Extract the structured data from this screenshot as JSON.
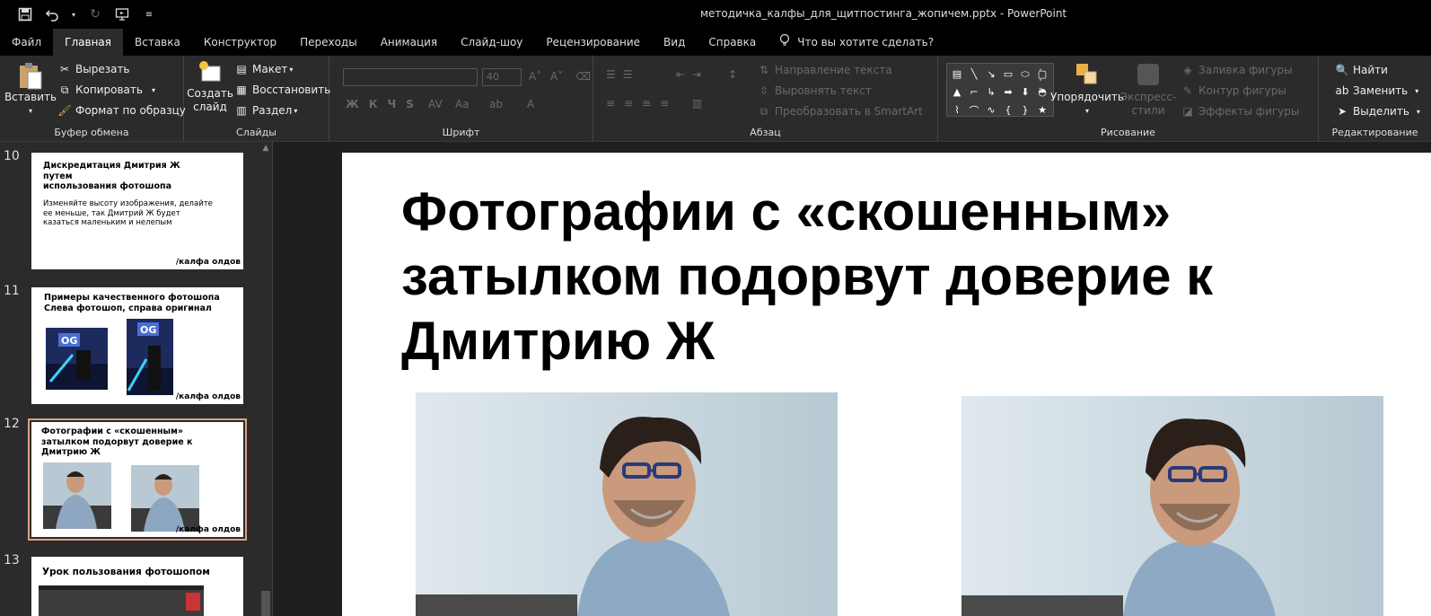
{
  "titlebar": {
    "title": "методичка_калфы_для_щитпостинга_жопичем.pptx  -  PowerPoint",
    "icons": [
      "save-icon",
      "undo-icon",
      "redo-icon",
      "present-icon",
      "customize-icon"
    ]
  },
  "tabs": [
    "Файл",
    "Главная",
    "Вставка",
    "Конструктор",
    "Переходы",
    "Анимация",
    "Слайд-шоу",
    "Рецензирование",
    "Вид",
    "Справка"
  ],
  "tell_me": "Что вы хотите сделать?",
  "ribbon": {
    "clipboard": {
      "paste": "Вставить",
      "cut": "Вырезать",
      "copy": "Копировать",
      "format_painter": "Формат по образцу",
      "label": "Буфер обмена"
    },
    "slides": {
      "new_slide_1": "Создать",
      "new_slide_2": "слайд",
      "layout": "Макет",
      "reset": "Восстановить",
      "section": "Раздел",
      "label": "Слайды"
    },
    "font": {
      "label": "Шрифт",
      "size": "40"
    },
    "paragraph": {
      "text_direction": "Направление текста",
      "align_text": "Выровнять текст",
      "smartart": "Преобразовать в SmartArt",
      "label": "Абзац"
    },
    "drawing": {
      "arrange": "Упорядочить",
      "quick_styles_1": "Экспресс-",
      "quick_styles_2": "стили",
      "shape_fill": "Заливка фигуры",
      "shape_outline": "Контур фигуры",
      "shape_effects": "Эффекты фигуры",
      "label": "Рисование"
    },
    "editing": {
      "find": "Найти",
      "replace": "Заменить",
      "select": "Выделить",
      "label": "Редактирование"
    }
  },
  "thumbnails": [
    {
      "num": "10",
      "title": "Дискредитация Дмитрия Ж\nпутем\nиспользования фотошопа",
      "body": "Изменяйте высоту изображения, делайте\nее меньше, так  Дмитрий Ж будет\nказаться маленьким и нелепым",
      "sign": "/калфа олдов"
    },
    {
      "num": "11",
      "title": "Примеры качественного фотошопа\nСлева фотошоп, справа оригинал",
      "sign": "/калфа олдов"
    },
    {
      "num": "12",
      "title": "Фотографии с «скошенным»\nзатылком подорвут доверие к\nДмитрию Ж",
      "sign": "/калфа олдов"
    },
    {
      "num": "13",
      "title": "Урок пользования фотошопом"
    }
  ],
  "slide": {
    "title": "Фотографии с «скошенным» затылком подорвут доверие к Дмитрию Ж"
  },
  "colors": {
    "accent": "#e0a080",
    "ribbon_bg": "#2b2b2b",
    "titlebar_bg": "#000000"
  }
}
